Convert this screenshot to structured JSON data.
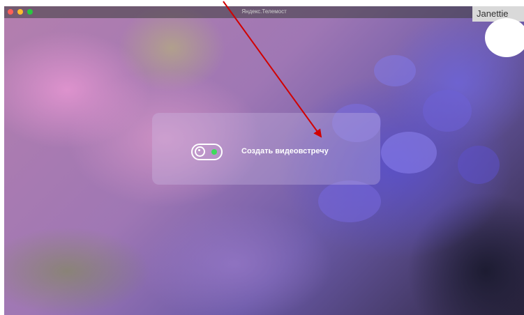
{
  "window": {
    "title": "Яндекс.Телемост",
    "traffic_lights": {
      "close": "#ff5f57",
      "minimize": "#febc2e",
      "zoom": "#28c840"
    }
  },
  "participant": {
    "name": "Janettie"
  },
  "meeting": {
    "create_label": "Создать видеовстречу",
    "icon": "camera-toggle-icon",
    "status_color": "#3ddc5a"
  },
  "annotation": {
    "arrow_color": "#d10000"
  }
}
